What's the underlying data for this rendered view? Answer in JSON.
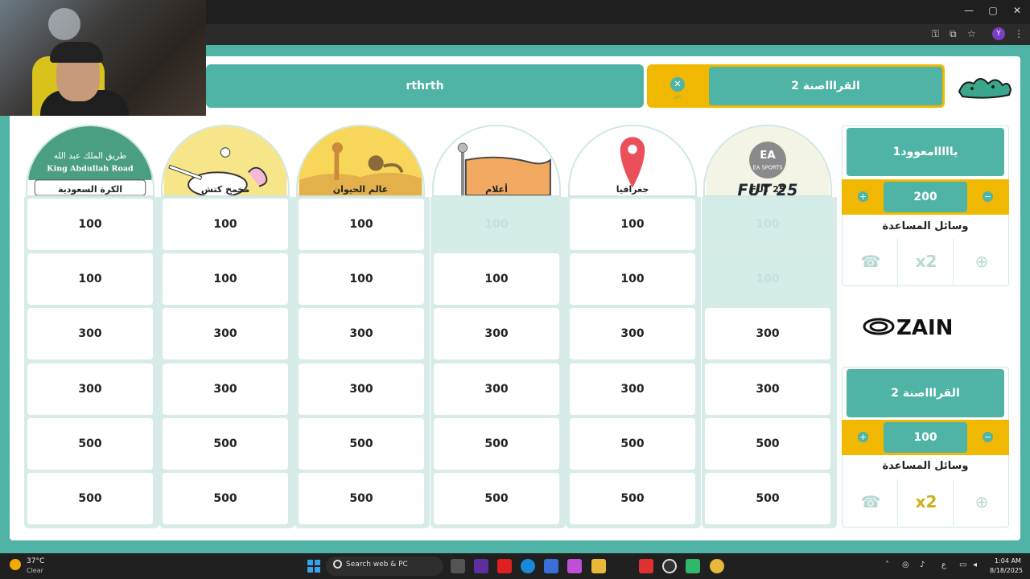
{
  "browser": {
    "window_controls": [
      "—",
      "▢",
      "✕"
    ],
    "profile_initial": "Y"
  },
  "header": {
    "team_left_name": "rthrth",
    "team_right_name": "القراااصنة 2",
    "turn_icon_label": "دور"
  },
  "categories": [
    {
      "label": "FUT 25",
      "art": "fut"
    },
    {
      "label": "جغرافيا",
      "art": "geo"
    },
    {
      "label": "أعلام",
      "art": "flags"
    },
    {
      "label": "عالم الحيوان",
      "art": "animals"
    },
    {
      "label": "مخمخ كتش",
      "art": "mkhmkh"
    },
    {
      "label": "الكرة السعودية",
      "art": "saudi"
    }
  ],
  "category_art_text": {
    "fut_badge": "EA SPORTS",
    "fut_overlay": "FUT 25",
    "saudi_arabic": "طريق الملك عبد الله",
    "saudi_english": "King Abdullah Road"
  },
  "grid": {
    "rows": [
      [
        {
          "v": "100",
          "used": true
        },
        {
          "v": "100",
          "used": false
        },
        {
          "v": "100",
          "used": true
        },
        {
          "v": "100",
          "used": false
        },
        {
          "v": "100",
          "used": false
        },
        {
          "v": "100",
          "used": false
        }
      ],
      [
        {
          "v": "100",
          "used": true
        },
        {
          "v": "100",
          "used": false
        },
        {
          "v": "100",
          "used": false
        },
        {
          "v": "100",
          "used": false
        },
        {
          "v": "100",
          "used": false
        },
        {
          "v": "100",
          "used": false
        }
      ],
      [
        {
          "v": "300",
          "used": false
        },
        {
          "v": "300",
          "used": false
        },
        {
          "v": "300",
          "used": false
        },
        {
          "v": "300",
          "used": false
        },
        {
          "v": "300",
          "used": false
        },
        {
          "v": "300",
          "used": false
        }
      ],
      [
        {
          "v": "300",
          "used": false
        },
        {
          "v": "300",
          "used": false
        },
        {
          "v": "300",
          "used": false
        },
        {
          "v": "300",
          "used": false
        },
        {
          "v": "300",
          "used": false
        },
        {
          "v": "300",
          "used": false
        }
      ],
      [
        {
          "v": "500",
          "used": false
        },
        {
          "v": "500",
          "used": false
        },
        {
          "v": "500",
          "used": false
        },
        {
          "v": "500",
          "used": false
        },
        {
          "v": "500",
          "used": false
        },
        {
          "v": "500",
          "used": false
        }
      ],
      [
        {
          "v": "500",
          "used": false
        },
        {
          "v": "500",
          "used": false
        },
        {
          "v": "500",
          "used": false
        },
        {
          "v": "500",
          "used": false
        },
        {
          "v": "500",
          "used": false
        },
        {
          "v": "500",
          "used": false
        }
      ]
    ]
  },
  "teams": [
    {
      "name": "يااااامعوود1",
      "score": "200",
      "aids_title": "وسائل المساعدة"
    },
    {
      "name": "القراااصنة 2",
      "score": "100",
      "aids_title": "وسائل المساعدة"
    }
  ],
  "sponsor": "ZAIN",
  "taskbar": {
    "weather_temp": "37°C",
    "weather_desc": "Clear",
    "search_label": "Search web & PC",
    "time": "1:04 AM",
    "date": "8/18/2025",
    "lang": "ع"
  },
  "colors": {
    "teal": "#4fb3a5",
    "gold": "#f0b800",
    "used_cell": "#d3ece8"
  }
}
